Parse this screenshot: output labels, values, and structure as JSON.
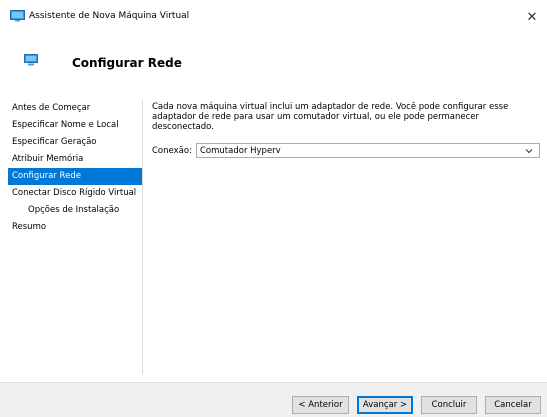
{
  "window": {
    "title": "Assistente de Nova Máquina Virtual",
    "close_glyph": "✕"
  },
  "header": {
    "title": "Configurar Rede"
  },
  "sidebar": {
    "items": [
      {
        "label": "Antes de Começar"
      },
      {
        "label": "Especificar Nome e Local"
      },
      {
        "label": "Especificar Geração"
      },
      {
        "label": "Atribuir Memória"
      },
      {
        "label": "Configurar Rede"
      },
      {
        "label": "Conectar Disco Rígido Virtual"
      },
      {
        "label": "Opções de Instalação"
      },
      {
        "label": "Resumo"
      }
    ],
    "active_index": 4
  },
  "content": {
    "description": "Cada nova máquina virtual inclui um adaptador de rede. Você pode configurar esse adaptador de rede para usar um comutador virtual, ou ele pode permanecer desconectado.",
    "connection_label": "Conexão:",
    "connection_value": "Comutador Hyperv"
  },
  "footer": {
    "previous_label": "< Anterior",
    "next_label": "Avançar >",
    "finish_label": "Concluir",
    "cancel_label": "Cancelar"
  },
  "icons": {
    "title": "monitor-icon",
    "header": "monitor-icon",
    "dropdown": "chevron-down-icon",
    "close": "close-icon"
  },
  "colors": {
    "accent": "#0078d7",
    "footer_bg": "#f0f0f0",
    "button_bg": "#e1e1e1"
  }
}
